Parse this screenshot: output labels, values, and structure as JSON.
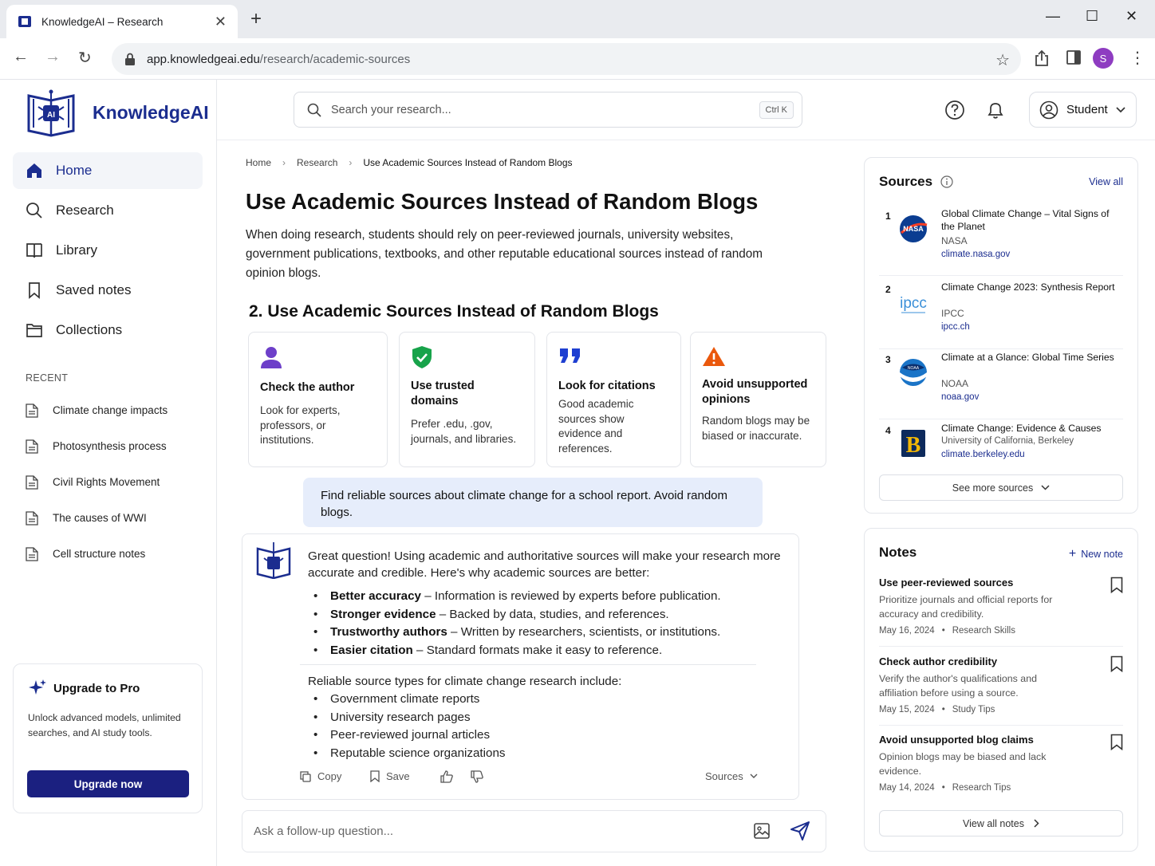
{
  "browser": {
    "tab_title": "KnowledgeAI – Research",
    "url_host": "app.knowledgeai.edu",
    "url_path": "/research/academic-sources",
    "profile_initial": "S"
  },
  "sidebar": {
    "brand": "KnowledgeAI",
    "logo_text": "AI",
    "nav": [
      {
        "label": "Home",
        "icon": "home-icon"
      },
      {
        "label": "Research",
        "icon": "search-icon"
      },
      {
        "label": "Library",
        "icon": "book-icon"
      },
      {
        "label": "Saved notes",
        "icon": "bookmark-icon"
      },
      {
        "label": "Collections",
        "icon": "folder-icon"
      }
    ],
    "recent_label": "RECENT",
    "recent": [
      "Climate change impacts",
      "Photosynthesis process",
      "Civil Rights Movement",
      "The causes of WWI",
      "Cell structure notes"
    ],
    "upgrade": {
      "title": "Upgrade to Pro",
      "desc": "Unlock advanced models, unlimited searches, and AI study tools.",
      "button": "Upgrade now"
    }
  },
  "header": {
    "search_placeholder": "Search your research...",
    "shortcut": "Ctrl  K",
    "user": "Student"
  },
  "main": {
    "breadcrumb": [
      "Home",
      "Research",
      "Use Academic Sources Instead of Random Blogs"
    ],
    "title": "Use Academic Sources Instead of Random Blogs",
    "intro": "When doing research, students should rely on peer-reviewed journals, university websites, government publications, textbooks, and other reputable educational sources instead of random opinion blogs.",
    "section_heading": "2. Use Academic Sources Instead of Random Blogs",
    "cards": [
      {
        "title": "Check the author",
        "desc": "Look for experts, professors, or institutions.",
        "icon": "person-icon"
      },
      {
        "title": "Use trusted domains",
        "desc": "Prefer .edu, .gov, journals, and libraries.",
        "icon": "shield-check-icon"
      },
      {
        "title": "Look for citations",
        "desc": "Good academic sources show evidence and references.",
        "icon": "quote-icon"
      },
      {
        "title": "Avoid unsupported opinions",
        "desc": "Random blogs may be biased or inaccurate.",
        "icon": "warning-icon"
      }
    ],
    "user_message": "Find reliable sources about climate change for a school report. Avoid random blogs.",
    "answer": {
      "intro": "Great question! Using academic and authoritative sources will make your research more accurate and credible. Here's why academic sources are better:",
      "benefits": [
        {
          "bold": "Better accuracy",
          "text": " – Information is reviewed by experts before publication."
        },
        {
          "bold": "Stronger evidence",
          "text": " – Backed by data, studies, and references."
        },
        {
          "bold": "Trustworthy authors",
          "text": " – Written by researchers, scientists, or institutions."
        },
        {
          "bold": "Easier citation",
          "text": " – Standard formats make it easy to reference."
        }
      ],
      "types_intro": "Reliable source types for climate change research include:",
      "types": [
        "Government climate reports",
        "University research pages",
        "Peer-reviewed journal articles",
        "Reputable science organizations"
      ],
      "actions": {
        "copy": "Copy",
        "save": "Save",
        "sources": "Sources"
      }
    },
    "followup_placeholder": "Ask a follow-up question..."
  },
  "sources_panel": {
    "title": "Sources",
    "view_all": "View all",
    "items": [
      {
        "num": "1",
        "title": "Global Climate Change – Vital Signs of the Planet",
        "publisher": "NASA",
        "domain": "climate.nasa.gov",
        "logo_text": "NASA"
      },
      {
        "num": "2",
        "title": "Climate Change 2023: Synthesis Report",
        "publisher": "IPCC",
        "domain": "ipcc.ch",
        "logo_text": "ipcc"
      },
      {
        "num": "3",
        "title": "Climate at a Glance: Global Time Series",
        "publisher": "NOAA",
        "domain": "noaa.gov",
        "logo_text": "NOAA"
      },
      {
        "num": "4",
        "title": "Climate Change: Evidence & Causes",
        "publisher": "University of California, Berkeley",
        "domain": "climate.berkeley.edu",
        "logo_text": "B"
      }
    ],
    "see_more": "See more sources"
  },
  "notes_panel": {
    "title": "Notes",
    "new_note": "New note",
    "items": [
      {
        "title": "Use peer-reviewed sources",
        "desc": "Prioritize journals and official reports for accuracy and credibility.",
        "date": "May 16, 2024",
        "tag": "Research Skills"
      },
      {
        "title": "Check author credibility",
        "desc": "Verify the author's qualifications and affiliation before using a source.",
        "date": "May 15, 2024",
        "tag": "Study Tips"
      },
      {
        "title": "Avoid unsupported blog claims",
        "desc": "Opinion blogs may be biased and lack evidence.",
        "date": "May 14, 2024",
        "tag": "Research Tips"
      }
    ],
    "view_all": "View all notes"
  },
  "colors": {
    "brand": "#1b2d8f",
    "upgrade_button": "#1b2080",
    "bubble": "#e6edfb",
    "success": "#17a34a",
    "warning": "#ea580c",
    "purple": "#6d3fc9"
  }
}
